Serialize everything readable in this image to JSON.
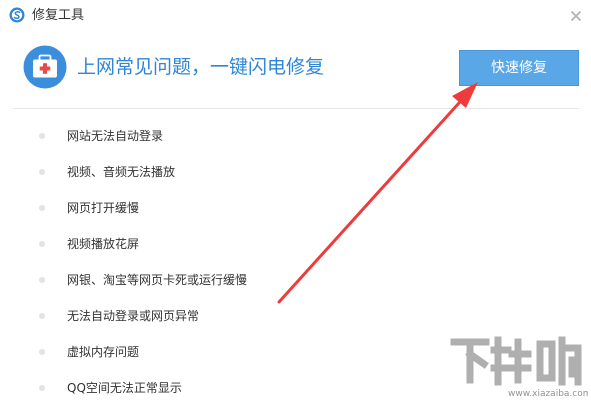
{
  "window": {
    "title": "修复工具",
    "close_symbol": "×",
    "app_icon": "browser-logo-icon",
    "close_icon": "close-icon"
  },
  "header": {
    "icon": "first-aid-kit-icon",
    "headline": "上网常见问题，一键闪电修复",
    "fix_button_label": "快速修复"
  },
  "issues": [
    "网站无法自动登录",
    "视频、音频无法播放",
    "网页打开缓慢",
    "视频播放花屏",
    "网银、淘宝等网页卡死或运行缓慢",
    "无法自动登录或网页异常",
    "虚拟内存问题",
    "QQ空间无法正常显示"
  ],
  "annotation": {
    "arrow_icon": "red-arrow-icon"
  },
  "watermark": {
    "brand": "下载吧",
    "url": "www.xiazaiba.com"
  },
  "colors": {
    "accent_blue": "#2f86d6",
    "button_blue": "#5aa7e8",
    "arrow_red": "#ee3b3b",
    "kit_blue": "#3b8edb"
  }
}
